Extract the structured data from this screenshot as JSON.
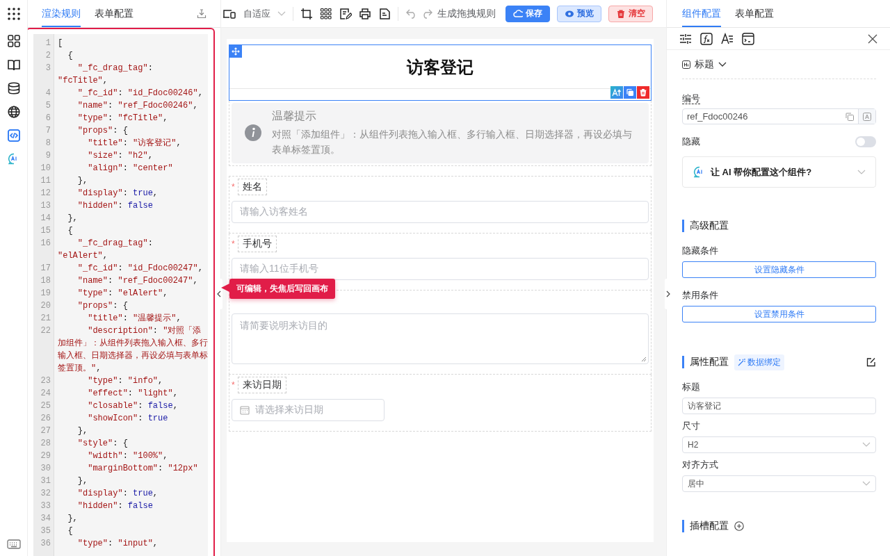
{
  "app_rail": {
    "items": [
      {
        "kind": "apps",
        "selected": false
      },
      {
        "kind": "components",
        "selected": false
      },
      {
        "kind": "book",
        "selected": false
      },
      {
        "kind": "database",
        "selected": false
      },
      {
        "kind": "globe",
        "selected": false
      },
      {
        "kind": "code",
        "selected": true
      },
      {
        "kind": "ai",
        "selected": false
      }
    ],
    "bottom": [
      {
        "kind": "keyboard",
        "selected": false
      }
    ]
  },
  "left_panel": {
    "tabs": [
      {
        "label": "渲染规则",
        "selected": true
      },
      {
        "label": "表单配置",
        "selected": false
      }
    ],
    "editor": {
      "lines": [
        {
          "num": "1",
          "text": "["
        },
        {
          "num": "2",
          "text": "  {"
        },
        {
          "num": "3",
          "text": "    \"_fc_drag_tag\": \"fcTitle\","
        },
        {
          "num": "4",
          "text": "    \"_fc_id\": \"id_Fdoc00246\","
        },
        {
          "num": "5",
          "text": "    \"name\": \"ref_Fdoc00246\","
        },
        {
          "num": "6",
          "text": "    \"type\": \"fcTitle\","
        },
        {
          "num": "7",
          "text": "    \"props\": {"
        },
        {
          "num": "8",
          "text": "      \"title\": \"访客登记\","
        },
        {
          "num": "9",
          "text": "      \"size\": \"h2\","
        },
        {
          "num": "10",
          "text": "      \"align\": \"center\""
        },
        {
          "num": "11",
          "text": "    },"
        },
        {
          "num": "12",
          "text": "    \"display\": true,"
        },
        {
          "num": "13",
          "text": "    \"hidden\": false"
        },
        {
          "num": "14",
          "text": "  },"
        },
        {
          "num": "15",
          "text": "  {"
        },
        {
          "num": "16",
          "text": "    \"_fc_drag_tag\": \"elAlert\","
        },
        {
          "num": "17",
          "text": "    \"_fc_id\": \"id_Fdoc00247\","
        },
        {
          "num": "18",
          "text": "    \"name\": \"ref_Fdoc00247\","
        },
        {
          "num": "19",
          "text": "    \"type\": \"elAlert\","
        },
        {
          "num": "20",
          "text": "    \"props\": {"
        },
        {
          "num": "21",
          "text": "      \"title\": \"温馨提示\","
        },
        {
          "num": "22",
          "text": "      \"description\": \"对照「添加组件」：从组件列表拖入输入框、多行输入框、日期选择器，再设必填与表单标签置顶。\","
        },
        {
          "num": "23",
          "text": "      \"type\": \"info\","
        },
        {
          "num": "24",
          "text": "      \"effect\": \"light\","
        },
        {
          "num": "25",
          "text": "      \"closable\": false,"
        },
        {
          "num": "26",
          "text": "      \"showIcon\": true"
        },
        {
          "num": "27",
          "text": "    },"
        },
        {
          "num": "28",
          "text": "    \"style\": {"
        },
        {
          "num": "29",
          "text": "      \"width\": \"100%\","
        },
        {
          "num": "30",
          "text": "      \"marginBottom\": \"12px\""
        },
        {
          "num": "31",
          "text": "    },"
        },
        {
          "num": "32",
          "text": "    \"display\": true,"
        },
        {
          "num": "33",
          "text": "    \"hidden\": false"
        },
        {
          "num": "34",
          "text": "  },"
        },
        {
          "num": "35",
          "text": "  {"
        },
        {
          "num": "36",
          "text": "    \"type\": \"input\","
        }
      ]
    },
    "tooltip": "可编辑，失焦后写回画布"
  },
  "toolbar": {
    "device_select": "自适应",
    "tools": [
      {
        "kind": "crop"
      },
      {
        "kind": "grid"
      },
      {
        "kind": "edit"
      },
      {
        "kind": "print"
      },
      {
        "kind": "file"
      }
    ],
    "undo": {
      "disabled": true
    },
    "redo": {
      "disabled": true
    },
    "generate": "生成拖拽规则",
    "buttons": [
      {
        "kind": "primary",
        "label": "保存"
      },
      {
        "kind": "plain",
        "label": "预览"
      },
      {
        "kind": "danger",
        "label": "清空"
      }
    ]
  },
  "canvas": {
    "required_mark": "*",
    "title": {
      "text": "访客登记",
      "selected": true
    },
    "alert": {
      "title": "温馨提示",
      "description": "对照「添加组件」：从组件列表拖入输入框、多行输入框、日期选择器，再设必填与表单标签置顶。"
    },
    "fields": [
      {
        "kind": "input",
        "label": "姓名",
        "required": true,
        "placeholder": "请输入访客姓名"
      },
      {
        "kind": "input",
        "label": "手机号",
        "required": true,
        "placeholder": "请输入11位手机号"
      },
      {
        "kind": "textarea",
        "required": false,
        "placeholder": "请简要说明来访目的"
      },
      {
        "kind": "date",
        "label": "来访日期",
        "required": true,
        "placeholder": "请选择来访日期"
      }
    ]
  },
  "right_panel": {
    "tabs": [
      {
        "label": "组件配置",
        "selected": true
      },
      {
        "label": "表单配置",
        "selected": false
      }
    ],
    "component_type": "标题",
    "id_label": "编号",
    "id_value": "ref_Fdoc00246",
    "hidden_label": "隐藏",
    "hidden_on": false,
    "ai_prompt": "让 AI 帮你配置这个组件?",
    "advanced": {
      "title": "高级配置",
      "hide_label": "隐藏条件",
      "hide_button": "设置隐藏条件",
      "disable_label": "禁用条件",
      "disable_button": "设置禁用条件"
    },
    "props": {
      "title": "属性配置",
      "binding_tag": "数据绑定",
      "fields": [
        {
          "kind": "input",
          "label": "标题",
          "value": "访客登记"
        },
        {
          "kind": "select",
          "label": "尺寸",
          "value": "H2"
        },
        {
          "kind": "select",
          "label": "对齐方式",
          "value": "居中"
        }
      ]
    },
    "slots": {
      "title": "插槽配置"
    }
  }
}
